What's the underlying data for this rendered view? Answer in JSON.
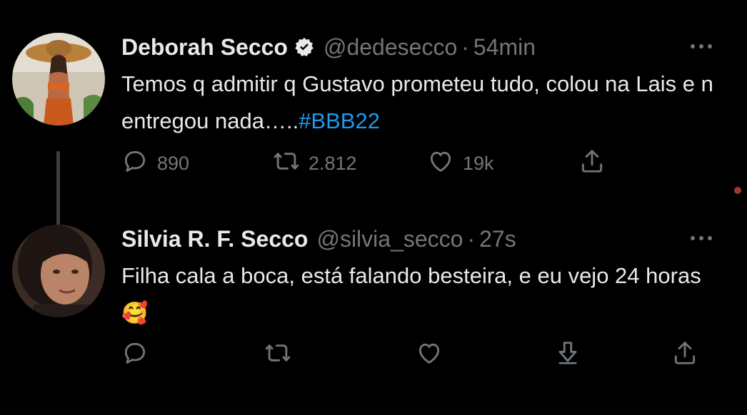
{
  "tweets": [
    {
      "author_name": "Deborah Secco",
      "verified": true,
      "handle": "@dedesecco",
      "separator": "·",
      "time": "54min",
      "text": "Temos q admitir q Gustavo prometeu tudo, colou na Lais e n entregou nada…..",
      "hashtag": "#BBB22",
      "replies": "890",
      "retweets": "2.812",
      "likes": "19k"
    },
    {
      "author_name": "Silvia R. F. Secco",
      "verified": false,
      "handle": "@silvia_secco",
      "separator": "·",
      "time": "27s",
      "text": "Filha cala a boca, está falando besteira, e eu vejo 24 horas",
      "emoji": "🥰"
    }
  ],
  "colors": {
    "background": "#000000",
    "text": "#e7e9ea",
    "secondary": "#71767b",
    "link": "#1d9bf0",
    "thread_line": "#3b3f43"
  },
  "icons": [
    "verified-badge-icon",
    "more-icon",
    "reply-icon",
    "retweet-icon",
    "like-icon",
    "download-icon",
    "share-icon"
  ]
}
